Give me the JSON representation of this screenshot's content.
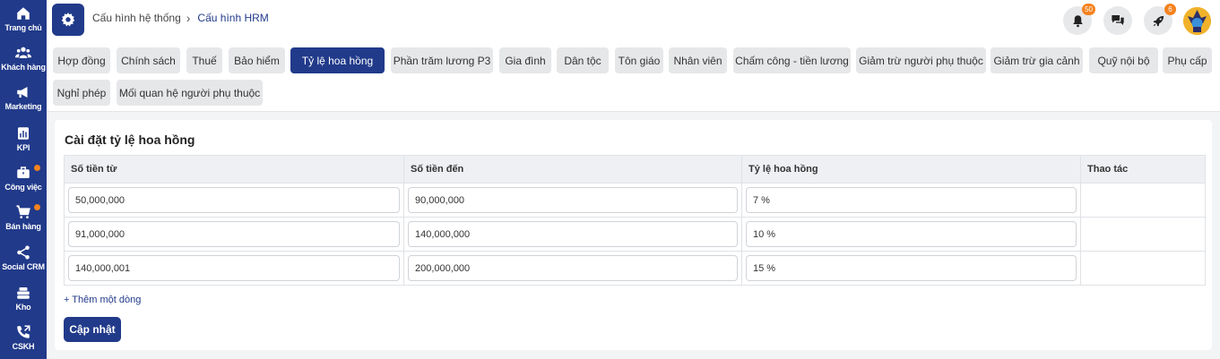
{
  "sidebar": {
    "items": [
      {
        "label": "Trang chủ",
        "icon": "home-icon"
      },
      {
        "label": "Khách hàng",
        "icon": "users-icon"
      },
      {
        "label": "Marketing",
        "icon": "megaphone-icon"
      },
      {
        "label": "KPI",
        "icon": "chart-icon"
      },
      {
        "label": "Công việc",
        "icon": "briefcase-icon"
      },
      {
        "label": "Bán hàng",
        "icon": "cart-icon"
      },
      {
        "label": "Social CRM",
        "icon": "share-icon"
      },
      {
        "label": "Kho",
        "icon": "warehouse-icon"
      },
      {
        "label": "CSKH",
        "icon": "phone-icon"
      }
    ]
  },
  "header": {
    "breadcrumb_parent": "Cấu hình hệ thống",
    "breadcrumb_current": "Cấu hình HRM",
    "notifications_count": "50",
    "rocket_count": "6"
  },
  "tabs": [
    {
      "label": "Hợp đồng"
    },
    {
      "label": "Chính sách"
    },
    {
      "label": "Thuế"
    },
    {
      "label": "Bảo hiểm"
    },
    {
      "label": "Tỷ lệ hoa hồng"
    },
    {
      "label": "Phần trăm lương P3"
    },
    {
      "label": "Gia đình"
    },
    {
      "label": "Dân tộc"
    },
    {
      "label": "Tôn giáo"
    },
    {
      "label": "Nhân viên"
    },
    {
      "label": "Chấm công - tiền lương"
    },
    {
      "label": "Giảm trừ người phụ thuộc"
    },
    {
      "label": "Giảm trừ gia cảnh"
    },
    {
      "label": "Quỹ nội bộ"
    },
    {
      "label": "Phụ cấp"
    },
    {
      "label": "Nghỉ phép"
    },
    {
      "label": "Mối quan hệ người phụ thuộc"
    }
  ],
  "active_tab": "Tỷ lệ hoa hồng",
  "main": {
    "title": "Cài đặt tỷ lệ hoa hồng",
    "columns": [
      "Số tiền từ",
      "Số tiền đến",
      "Tỷ lệ hoa hồng",
      "Thao tác"
    ],
    "rows": [
      {
        "from": "50,000,000",
        "to": "90,000,000",
        "rate": "7 %"
      },
      {
        "from": "91,000,000",
        "to": "140,000,000",
        "rate": "10 %"
      },
      {
        "from": "140,000,001",
        "to": "200,000,000",
        "rate": "15 %"
      }
    ],
    "add_row_label": "+ Thêm một dòng",
    "update_label": "Cập nhật"
  },
  "colors": {
    "primary": "#213a8a",
    "badge": "#f5821f",
    "tab_bg": "#e6e7e9"
  }
}
